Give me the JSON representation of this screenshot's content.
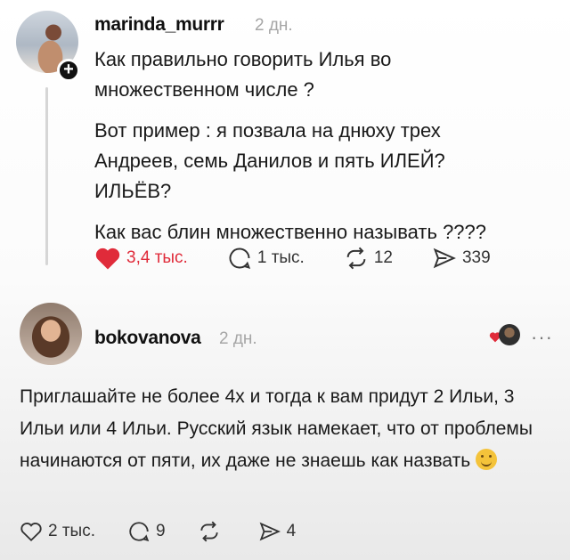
{
  "post": {
    "username": "marinda_murrr",
    "time": "2 дн.",
    "paragraphs": [
      "Как правильно говорить Илья во\nмножественном числе ?",
      "Вот пример : я позвала на днюху трех\nАндреев, семь Данилов и пять ИЛЕЙ?\nИЛЬЁВ?",
      "Как вас блин множественно называть ????"
    ],
    "likes": "3,4 тыс.",
    "comments": "1 тыс.",
    "reposts": "12",
    "shares": "339",
    "like_color": "#e02b3a"
  },
  "reply": {
    "username": "bokovanova",
    "time": "2 дн.",
    "text": "Приглашайте не более 4х и тогда к вам придут 2 Ильи, 3 Ильи или 4 Ильи. Русский язык намекает, что от проблемы начинаются от пяти, их даже не знаешь как назвать",
    "likes": "2 тыс.",
    "comments": "9",
    "reposts": "",
    "shares": "4",
    "more_label": "···"
  }
}
